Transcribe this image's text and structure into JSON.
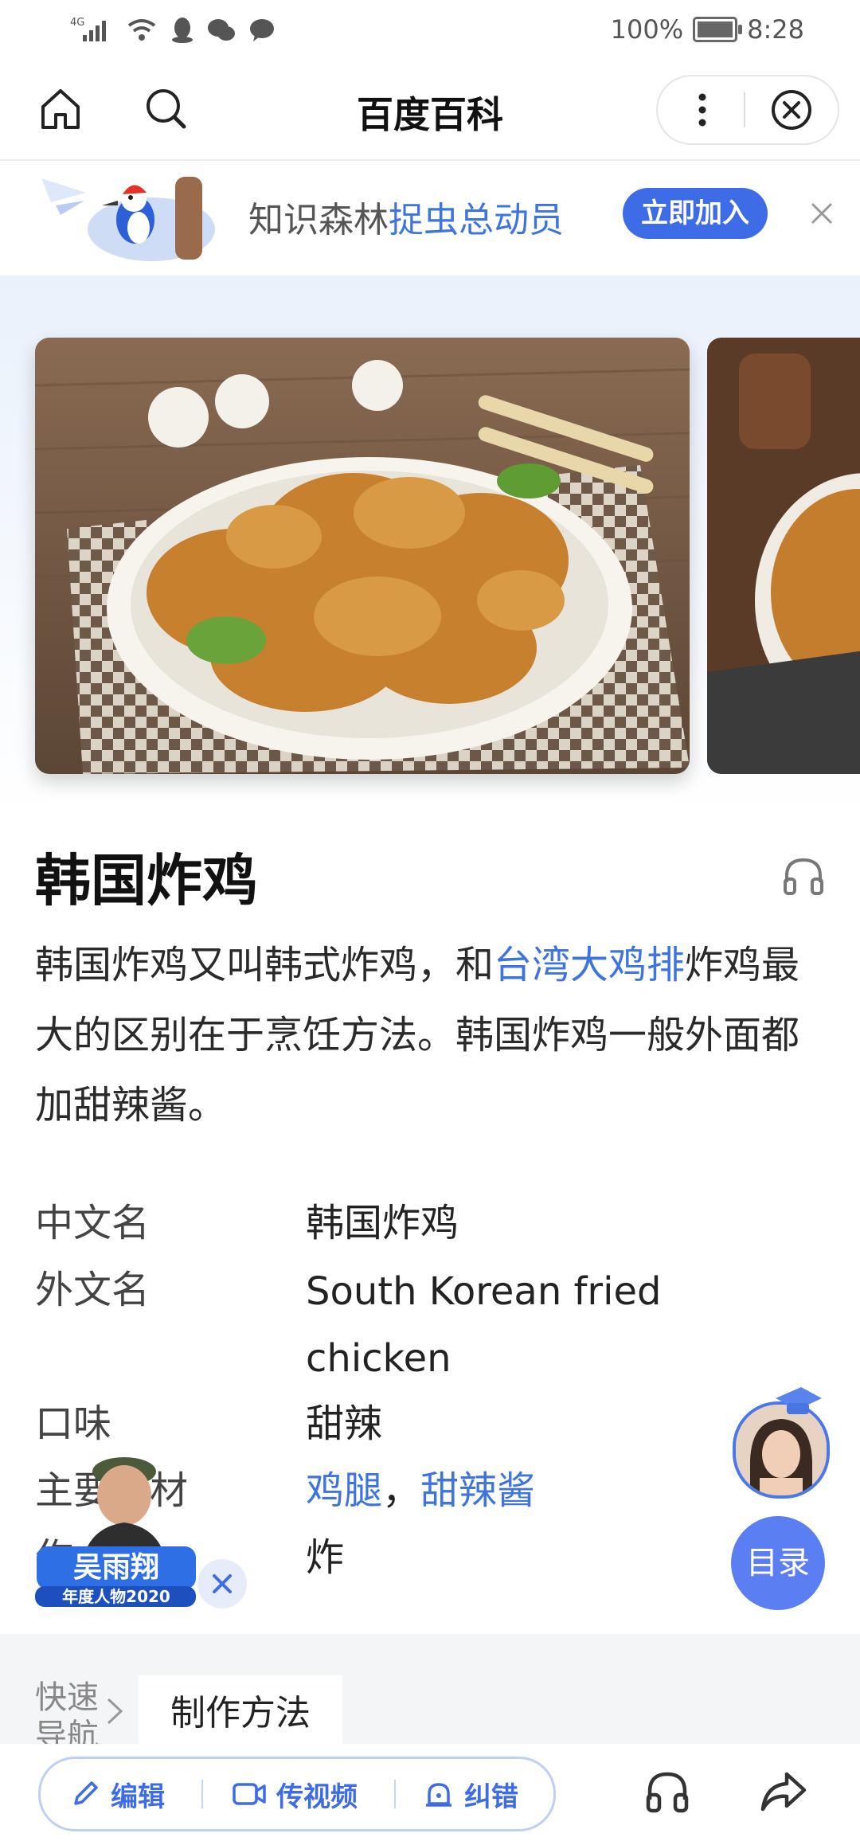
{
  "status_bar": {
    "network": "4G",
    "battery": "100%",
    "time": "8:28"
  },
  "nav": {
    "title": "百度百科",
    "icons": [
      "home-icon",
      "search-icon",
      "more-icon",
      "close-circle-icon"
    ]
  },
  "promo": {
    "text_prefix": "知识森林",
    "text_highlight": "捉虫总动员",
    "join_label": "立即加入",
    "icons": [
      "woodpecker-illustration",
      "close-icon"
    ]
  },
  "article": {
    "title": "韩国炸鸡",
    "summary_part1": "韩国炸鸡又叫韩式炸鸡，和",
    "summary_link": "台湾大鸡排",
    "summary_part2": "炸鸡最大的区别在于烹饪方法。韩国炸鸡一般外面都加甜辣酱。",
    "info": {
      "chinese_name_label": "中文名",
      "chinese_name_value": "韩国炸鸡",
      "foreign_name_label": "外文名",
      "foreign_name_value": "South Korean fried chicken",
      "taste_label": "口味",
      "taste_value": "甜辣",
      "ingredients_label": "主要食材",
      "ingredient_link1": "鸡腿",
      "ingredient_sep": "，",
      "ingredient_link2": "甜辣酱",
      "method_label_partial": "作",
      "method_value": "炸"
    }
  },
  "floating": {
    "toc_label": "目录",
    "badge_name": "吴雨翔",
    "badge_sub": "年度人物2020"
  },
  "quick_nav": {
    "label": "快速导航",
    "tab": "制作方法"
  },
  "toolbar": {
    "edit": "编辑",
    "upload_video": "传视频",
    "correct": "纠错",
    "icons": [
      "pencil-icon",
      "video-icon",
      "report-icon",
      "headphones-icon",
      "share-icon"
    ]
  },
  "colors": {
    "accent": "#3d74e0",
    "button": "#3d6ce6",
    "toc_button": "#5b7ff2"
  }
}
